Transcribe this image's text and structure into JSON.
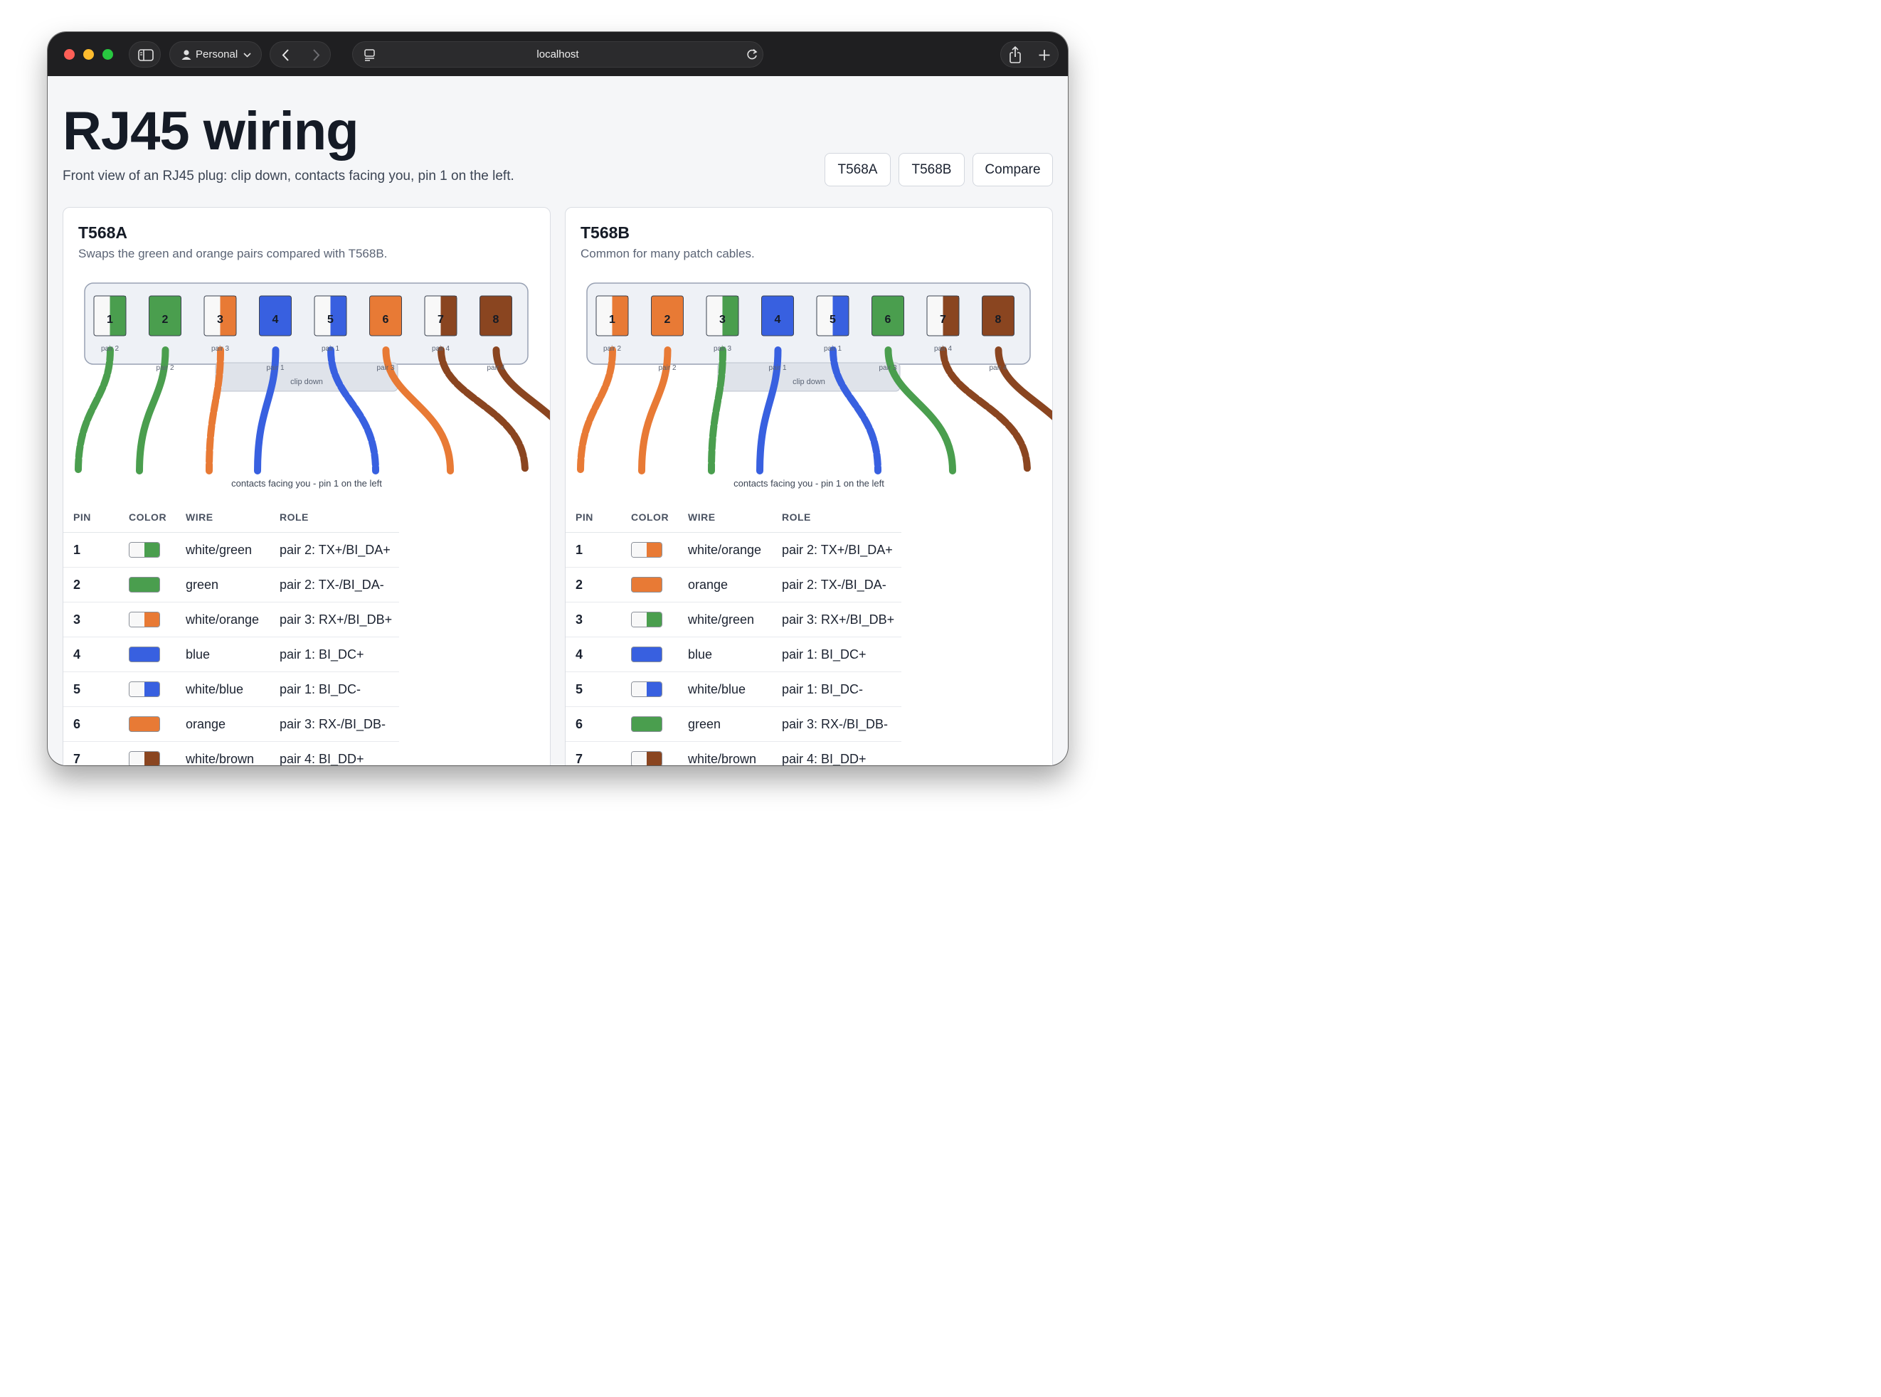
{
  "browser": {
    "profile": "Personal",
    "address": "localhost"
  },
  "page": {
    "title": "RJ45 wiring",
    "subtitle": "Front view of an RJ45 plug: clip down, contacts facing you, pin 1 on the left.",
    "modes": [
      "T568A",
      "T568B",
      "Compare"
    ]
  },
  "colors": {
    "green": "#4a9e4e",
    "orange": "#e87a35",
    "blue": "#3860e0",
    "brown": "#8a4520",
    "white": "#f8f8f8"
  },
  "diagram_labels": {
    "clip": "clip down",
    "caption": "contacts facing you - pin 1 on the left"
  },
  "table_headers": {
    "pin": "PIN",
    "color": "COLOR",
    "wire": "WIRE",
    "role": "ROLE"
  },
  "standards": [
    {
      "name": "T568A",
      "description": "Swaps the green and orange pairs compared with T568B.",
      "pins": [
        {
          "pin": "1",
          "base": "green",
          "striped": true,
          "wire": "white/green",
          "pair": "pair 2",
          "role": "pair 2: TX+/BI_DA+"
        },
        {
          "pin": "2",
          "base": "green",
          "striped": false,
          "wire": "green",
          "pair": "pair 2",
          "role": "pair 2: TX-/BI_DA-"
        },
        {
          "pin": "3",
          "base": "orange",
          "striped": true,
          "wire": "white/orange",
          "pair": "pair 3",
          "role": "pair 3: RX+/BI_DB+"
        },
        {
          "pin": "4",
          "base": "blue",
          "striped": false,
          "wire": "blue",
          "pair": "pair 1",
          "role": "pair 1: BI_DC+"
        },
        {
          "pin": "5",
          "base": "blue",
          "striped": true,
          "wire": "white/blue",
          "pair": "pair 1",
          "role": "pair 1: BI_DC-"
        },
        {
          "pin": "6",
          "base": "orange",
          "striped": false,
          "wire": "orange",
          "pair": "pair 3",
          "role": "pair 3: RX-/BI_DB-"
        },
        {
          "pin": "7",
          "base": "brown",
          "striped": true,
          "wire": "white/brown",
          "pair": "pair 4",
          "role": "pair 4: BI_DD+"
        },
        {
          "pin": "8",
          "base": "brown",
          "striped": false,
          "wire": "brown",
          "pair": "pair 4",
          "role": ""
        }
      ]
    },
    {
      "name": "T568B",
      "description": "Common for many patch cables.",
      "pins": [
        {
          "pin": "1",
          "base": "orange",
          "striped": true,
          "wire": "white/orange",
          "pair": "pair 2",
          "role": "pair 2: TX+/BI_DA+"
        },
        {
          "pin": "2",
          "base": "orange",
          "striped": false,
          "wire": "orange",
          "pair": "pair 2",
          "role": "pair 2: TX-/BI_DA-"
        },
        {
          "pin": "3",
          "base": "green",
          "striped": true,
          "wire": "white/green",
          "pair": "pair 3",
          "role": "pair 3: RX+/BI_DB+"
        },
        {
          "pin": "4",
          "base": "blue",
          "striped": false,
          "wire": "blue",
          "pair": "pair 1",
          "role": "pair 1: BI_DC+"
        },
        {
          "pin": "5",
          "base": "blue",
          "striped": true,
          "wire": "white/blue",
          "pair": "pair 1",
          "role": "pair 1: BI_DC-"
        },
        {
          "pin": "6",
          "base": "green",
          "striped": false,
          "wire": "green",
          "pair": "pair 3",
          "role": "pair 3: RX-/BI_DB-"
        },
        {
          "pin": "7",
          "base": "brown",
          "striped": true,
          "wire": "white/brown",
          "pair": "pair 4",
          "role": "pair 4: BI_DD+"
        },
        {
          "pin": "8",
          "base": "brown",
          "striped": false,
          "wire": "brown",
          "pair": "pair 4",
          "role": ""
        }
      ]
    }
  ]
}
